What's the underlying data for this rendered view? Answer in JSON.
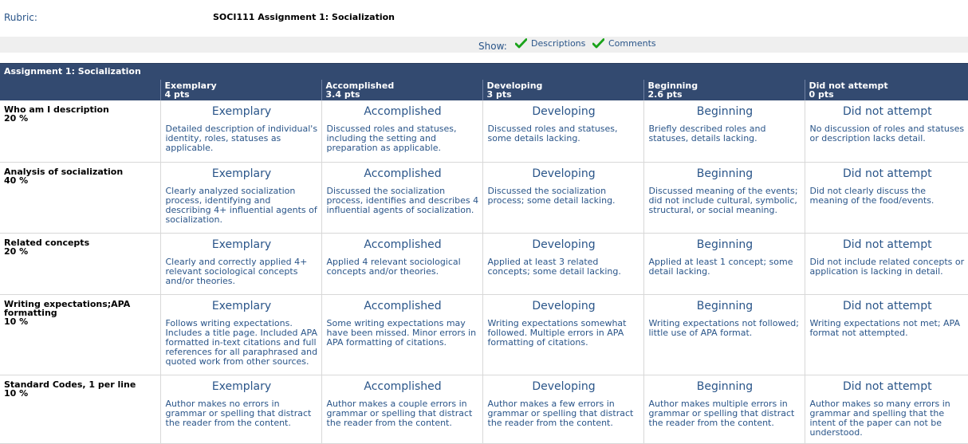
{
  "header": {
    "rubric_label": "Rubric:",
    "title": "SOCI111 Assignment 1: Socialization"
  },
  "show": {
    "label": "Show:",
    "descriptions_label": "Descriptions",
    "comments_label": "Comments",
    "descriptions_checked": true,
    "comments_checked": true
  },
  "table": {
    "caption": "Assignment 1: Socialization",
    "levels": [
      {
        "name": "Exemplary",
        "points": "4 pts"
      },
      {
        "name": "Accomplished",
        "points": "3.4 pts"
      },
      {
        "name": "Developing",
        "points": "3 pts"
      },
      {
        "name": "Beginning",
        "points": "2.6 pts"
      },
      {
        "name": "Did not attempt",
        "points": "0 pts"
      }
    ],
    "criteria": [
      {
        "name": "Who am I description",
        "weight": "20 %",
        "cells": [
          {
            "level": "Exemplary",
            "desc": "Detailed description of individual's identity, roles, statuses as applicable."
          },
          {
            "level": "Accomplished",
            "desc": "Discussed roles and statuses, including the setting and preparation as applicable."
          },
          {
            "level": "Developing",
            "desc": "Discussed roles and statuses, some details lacking."
          },
          {
            "level": "Beginning",
            "desc": "Briefly described roles and statuses, details lacking."
          },
          {
            "level": "Did not attempt",
            "desc": "No discussion of roles and statuses or description lacks detail."
          }
        ]
      },
      {
        "name": "Analysis of socialization",
        "weight": "40 %",
        "cells": [
          {
            "level": "Exemplary",
            "desc": "Clearly analyzed socialization process, identifying and describing 4+ influential agents of socialization."
          },
          {
            "level": "Accomplished",
            "desc": "Discussed the socialization process, identifies and describes 4 influential agents of socialization."
          },
          {
            "level": "Developing",
            "desc": "Discussed the socialization process; some detail lacking."
          },
          {
            "level": "Beginning",
            "desc": "Discussed meaning of the events; did not include cultural, symbolic, structural, or social meaning."
          },
          {
            "level": "Did not attempt",
            "desc": "Did not clearly discuss the meaning of the food/events."
          }
        ]
      },
      {
        "name": "Related concepts",
        "weight": "20 %",
        "cells": [
          {
            "level": "Exemplary",
            "desc": "Clearly and correctly applied 4+ relevant sociological concepts and/or theories."
          },
          {
            "level": "Accomplished",
            "desc": "Applied 4 relevant sociological concepts and/or theories."
          },
          {
            "level": "Developing",
            "desc": "Applied at least 3 related concepts; some detail lacking."
          },
          {
            "level": "Beginning",
            "desc": "Applied at least 1 concept; some detail lacking."
          },
          {
            "level": "Did not attempt",
            "desc": "Did not include related concepts or application is lacking in detail."
          }
        ]
      },
      {
        "name": "Writing expectations;APA formatting",
        "weight": "10 %",
        "cells": [
          {
            "level": "Exemplary",
            "desc": "Follows writing expectations. Includes a title page. Included APA formatted in-text citations and full references for all paraphrased and quoted work from other sources."
          },
          {
            "level": "Accomplished",
            "desc": "Some writing expectations may have been missed. Minor errors in APA formatting of citations."
          },
          {
            "level": "Developing",
            "desc": "Writing expectations somewhat followed. Multiple errors in APA formatting of citations."
          },
          {
            "level": "Beginning",
            "desc": "Writing expectations not followed; little use of APA format."
          },
          {
            "level": "Did not attempt",
            "desc": "Writing expectations not met; APA format not attempted."
          }
        ]
      },
      {
        "name": "Standard Codes, 1 per line",
        "weight": "10 %",
        "cells": [
          {
            "level": "Exemplary",
            "desc": "Author makes no errors in grammar or spelling that distract the reader from the content."
          },
          {
            "level": "Accomplished",
            "desc": "Author makes a couple errors in grammar or spelling that distract the reader from the content."
          },
          {
            "level": "Developing",
            "desc": "Author makes a few errors in grammar or spelling that distract the reader from the content."
          },
          {
            "level": "Beginning",
            "desc": "Author makes multiple errors in grammar or spelling that distract the reader from the content."
          },
          {
            "level": "Did not attempt",
            "desc": "Author makes so many errors in grammar and spelling that the intent of the paper can not be understood."
          }
        ]
      }
    ]
  },
  "colors": {
    "header_bg": "#334a70",
    "link_blue": "#2a5589",
    "check_green": "#1aa31a"
  }
}
